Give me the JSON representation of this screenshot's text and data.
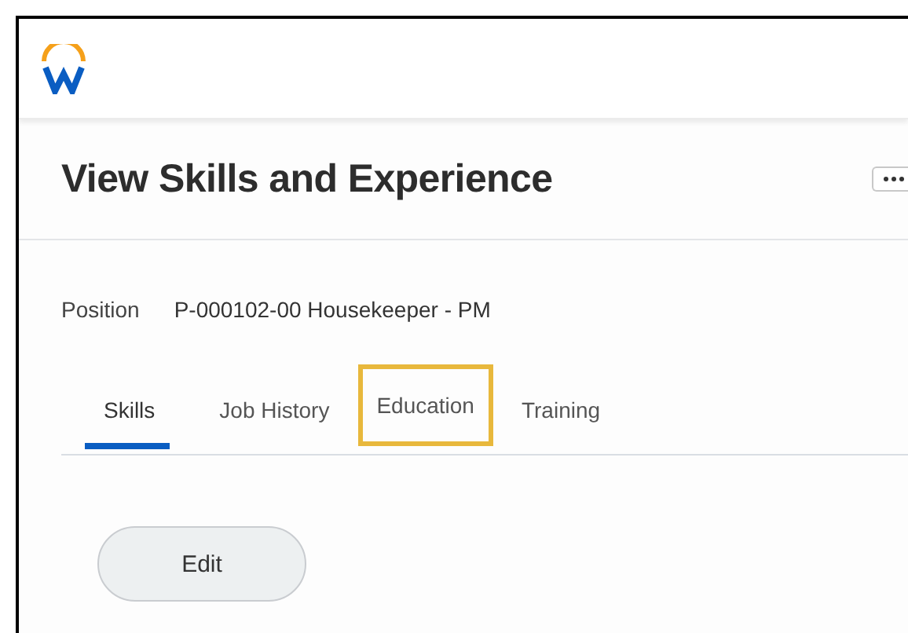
{
  "page": {
    "title": "View Skills and Experience"
  },
  "position": {
    "label": "Position",
    "value": "P-000102-00 Housekeeper - PM"
  },
  "tabs": [
    {
      "label": "Skills",
      "selected": true,
      "highlighted": false
    },
    {
      "label": "Job History",
      "selected": false,
      "highlighted": false
    },
    {
      "label": "Education",
      "selected": false,
      "highlighted": true
    },
    {
      "label": "Training",
      "selected": false,
      "highlighted": false
    }
  ],
  "buttons": [
    {
      "label": "Edit"
    }
  ]
}
